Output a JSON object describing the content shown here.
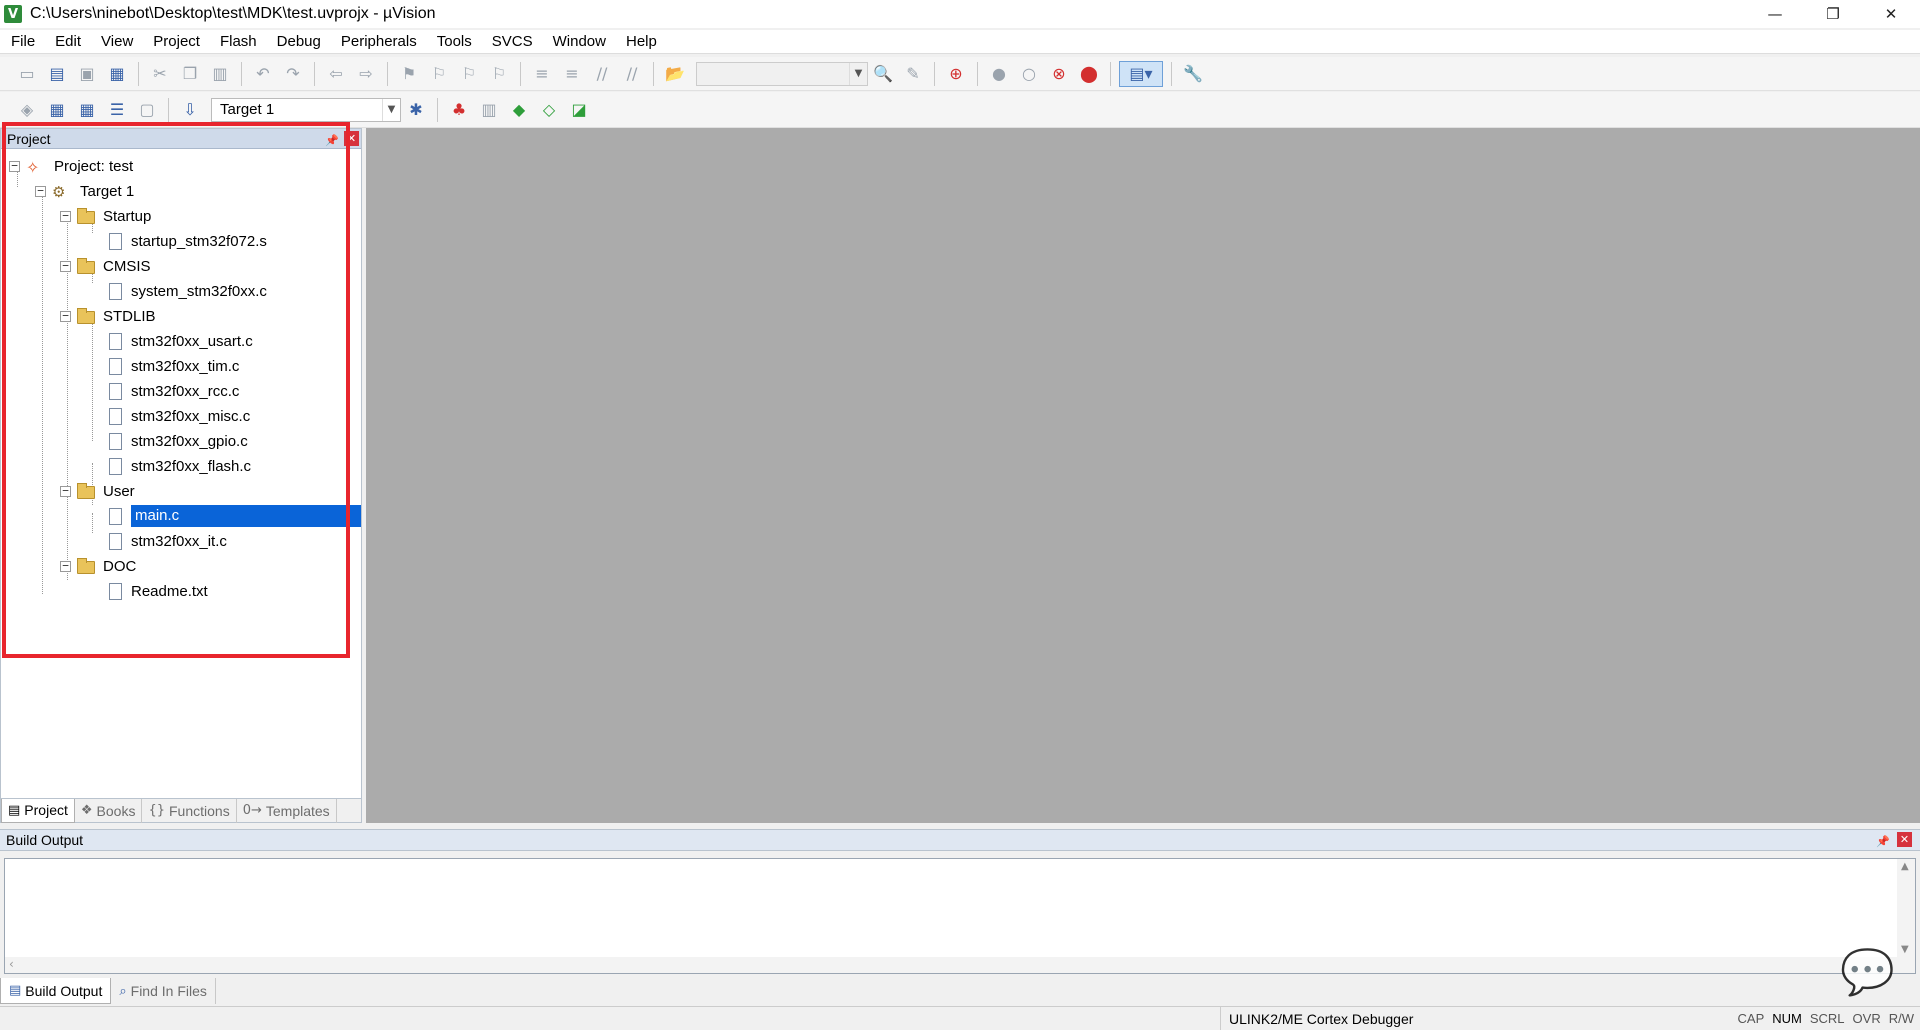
{
  "window": {
    "title": "C:\\Users\\ninebot\\Desktop\\test\\MDK\\test.uvprojx - µVision",
    "app_icon_letter": "V",
    "minimize": "—",
    "restore": "❐",
    "close": "✕"
  },
  "menu": [
    "File",
    "Edit",
    "View",
    "Project",
    "Flash",
    "Debug",
    "Peripherals",
    "Tools",
    "SVCS",
    "Window",
    "Help"
  ],
  "toolbar2": {
    "target_select": "Target 1"
  },
  "project_panel": {
    "title": "Project",
    "tree": {
      "project_label": "Project: test",
      "target_label": "Target 1",
      "groups": [
        {
          "name": "Startup",
          "files": [
            "startup_stm32f072.s"
          ]
        },
        {
          "name": "CMSIS",
          "files": [
            "system_stm32f0xx.c"
          ]
        },
        {
          "name": "STDLIB",
          "files": [
            "stm32f0xx_usart.c",
            "stm32f0xx_tim.c",
            "stm32f0xx_rcc.c",
            "stm32f0xx_misc.c",
            "stm32f0xx_gpio.c",
            "stm32f0xx_flash.c"
          ]
        },
        {
          "name": "User",
          "files": [
            "main.c",
            "stm32f0xx_it.c"
          ]
        },
        {
          "name": "DOC",
          "files": [
            "Readme.txt"
          ]
        }
      ],
      "selected_file": "main.c"
    },
    "tabs": [
      "Project",
      "Books",
      "Functions",
      "Templates"
    ],
    "active_tab": "Project"
  },
  "build_output": {
    "title": "Build Output",
    "tabs": [
      "Build Output",
      "Find In Files"
    ]
  },
  "statusbar": {
    "debugger": "ULINK2/ME Cortex Debugger",
    "keys": [
      "CAP",
      "NUM",
      "SCRL",
      "OVR",
      "R/W"
    ]
  },
  "colors": {
    "selection": "#0a64d8",
    "highlight_box": "#e8252d",
    "editor_bg": "#ababab"
  }
}
